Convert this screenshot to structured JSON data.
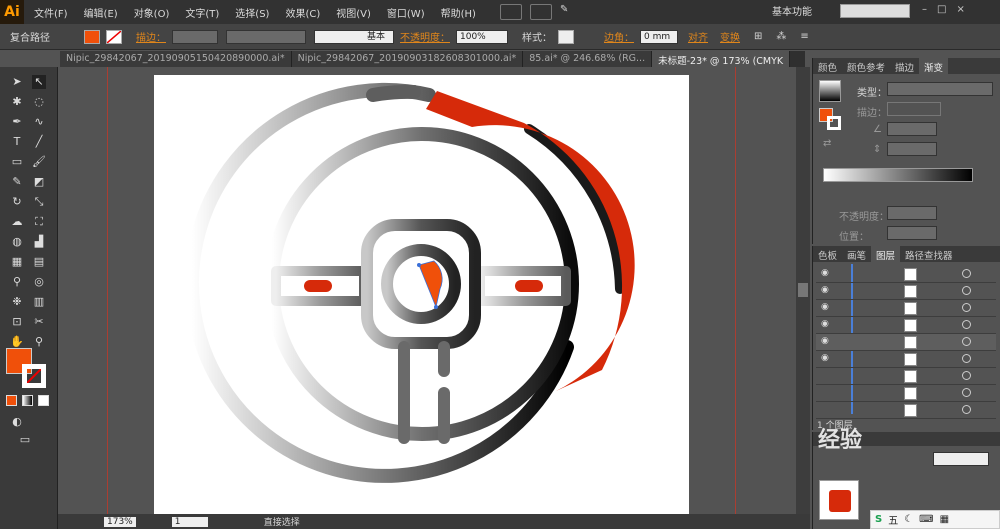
{
  "app": {
    "logo": "Ai",
    "workspace": "基本功能"
  },
  "menu": [
    "文件(F)",
    "编辑(E)",
    "对象(O)",
    "文字(T)",
    "选择(S)",
    "效果(C)",
    "视图(V)",
    "窗口(W)",
    "帮助(H)"
  ],
  "control_bar": {
    "selection_type": "复合路径",
    "stroke_label": "描边：",
    "stroke_profile": "基本",
    "opacity_label": "不透明度：",
    "opacity_value": "100%",
    "style_label": "样式：",
    "corner_label": "边角：",
    "corner_value": "0 mm",
    "align_label": "对齐",
    "transform_label": "变换"
  },
  "tabs": [
    "Nipic_29842067_20190905150420890000.ai*",
    "Nipic_29842067_20190903182608301000.ai*",
    "85.ai* @ 246.68% (RG...",
    "未标题-23* @ 173% (CMYK"
  ],
  "gradient_panel": {
    "tabs": [
      "颜色",
      "颜色参考",
      "描边",
      "渐变"
    ],
    "type_label": "类型：",
    "stroke_label": "描边：",
    "opacity_label": "不透明度：",
    "position_label": "位置："
  },
  "layers_panel": {
    "tabs": [
      "色板",
      "画笔",
      "图层",
      "路径查找器"
    ],
    "footer_text": "1 个图层"
  },
  "status": {
    "zoom": "173%",
    "page": "1",
    "tool_name": "直接选择"
  },
  "taskbar": {
    "ime": "五"
  },
  "watermark": "经验",
  "colors": {
    "accent_red": "#d62a0a",
    "accent_orange": "#f0500a",
    "fill_swatch": "#f0500a",
    "ui_bg": "#535353"
  }
}
